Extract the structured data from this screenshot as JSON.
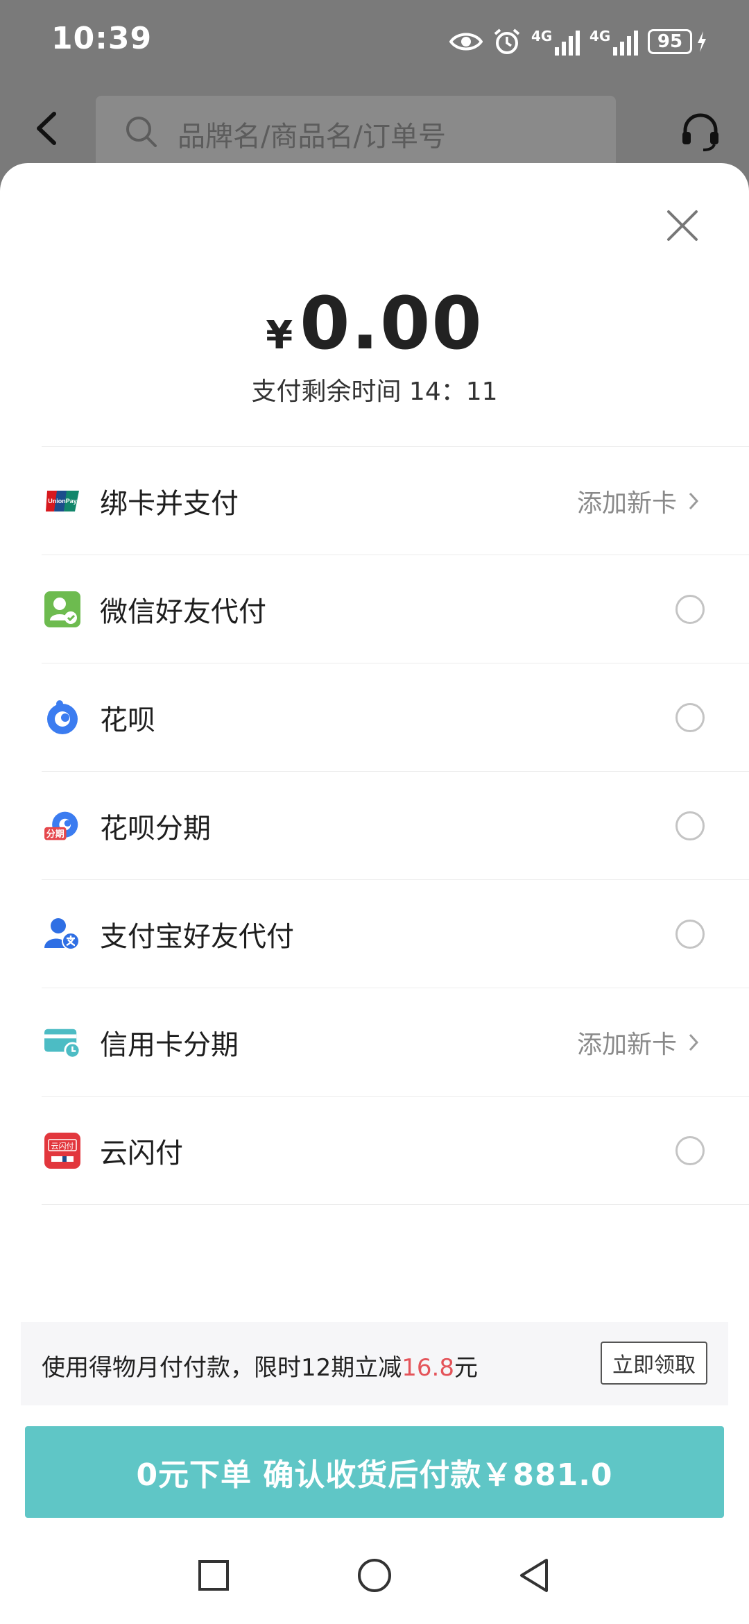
{
  "status_bar": {
    "time": "10:39",
    "battery": "95",
    "network_labels": [
      "4G",
      "4G"
    ]
  },
  "header": {
    "search_placeholder": "品牌名/商品名/订单号"
  },
  "payment": {
    "currency": "¥",
    "amount": "0.00",
    "countdown_label": "支付剩余时间",
    "countdown_value": "14：11"
  },
  "methods": [
    {
      "label": "绑卡并支付",
      "action": "添加新卡",
      "icon": "unionpay-icon"
    },
    {
      "label": "微信好友代付",
      "icon": "wechat-friend-icon"
    },
    {
      "label": "花呗",
      "icon": "huabei-icon"
    },
    {
      "label": "花呗分期",
      "icon": "huabei-installment-icon",
      "badge": "分期"
    },
    {
      "label": "支付宝好友代付",
      "icon": "alipay-friend-icon"
    },
    {
      "label": "信用卡分期",
      "action": "添加新卡",
      "icon": "credit-card-icon"
    },
    {
      "label": "云闪付",
      "icon": "quickpass-icon",
      "badge": "云闪付"
    }
  ],
  "promo": {
    "text_before": "使用得物月付付款，限时12期立减",
    "highlight": "16.8",
    "text_after": "元",
    "button": "立即领取"
  },
  "pay_button": {
    "label": "0元下单 确认收货后付款￥881.0"
  },
  "colors": {
    "accent": "#5fc6c6",
    "highlight": "#e4545a",
    "overlay": "#7a7a7a"
  }
}
